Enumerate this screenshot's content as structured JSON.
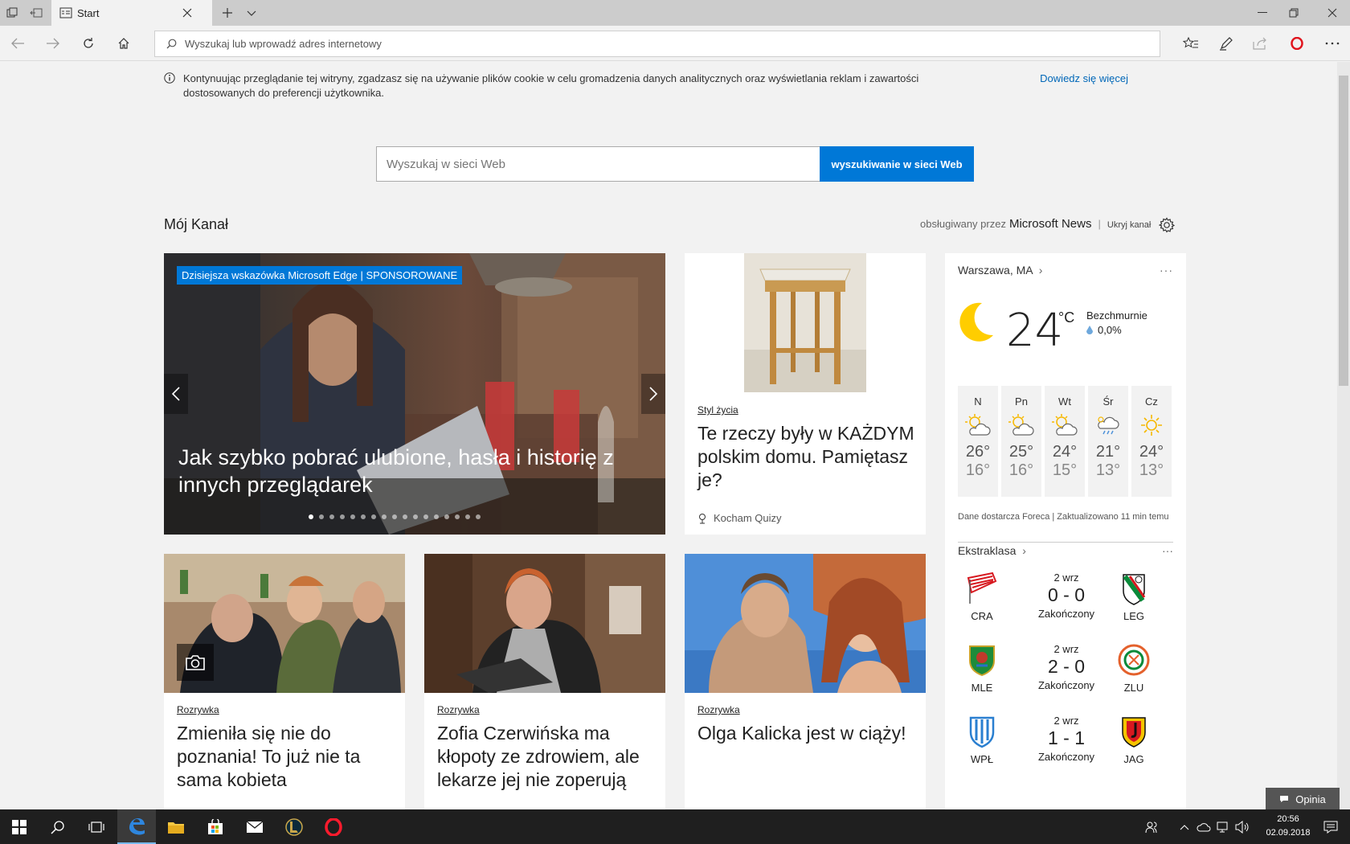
{
  "browser": {
    "tab_title": "Start",
    "address_placeholder": "Wyszukaj lub wprowadź adres internetowy"
  },
  "cookie_notice": {
    "text": "Kontynuując przeglądanie tej witryny, zgadzasz się na używanie plików cookie w celu gromadzenia danych analitycznych oraz wyświetlania reklam i zawartości dostosowanych do preferencji użytkownika.",
    "link": "Dowiedz się więcej"
  },
  "search": {
    "placeholder": "Wyszukaj w sieci Web",
    "button": "wyszukiwanie w sieci Web"
  },
  "feed": {
    "title": "Mój Kanał",
    "powered_by": "obsługiwany przez",
    "provider": "Microsoft News",
    "separator": "|",
    "hide": "Ukryj kanał"
  },
  "hero": {
    "tag": "Dzisiejsza wskazówka Microsoft Edge | SPONSOROWANE",
    "title": "Jak szybko pobrać ulubione, hasła i historię z innych przeglądarek",
    "slide_count": 17,
    "active_slide": 1
  },
  "card_lifestyle": {
    "category": "Styl życia",
    "headline": "Te rzeczy były w KAŻDYM polskim domu. Pamiętasz je?",
    "source": "Kocham Quizy"
  },
  "weather": {
    "location": "Warszawa, MA",
    "more": "···",
    "temp": "24",
    "unit": "°C",
    "condition": "Bezchmurnie",
    "precip": "0,0%",
    "forecast": [
      {
        "day": "N",
        "hi": "26°",
        "lo": "16°",
        "icon": "partly-sunny-icon"
      },
      {
        "day": "Pn",
        "hi": "25°",
        "lo": "16°",
        "icon": "partly-sunny-icon"
      },
      {
        "day": "Wt",
        "hi": "24°",
        "lo": "15°",
        "icon": "partly-sunny-icon"
      },
      {
        "day": "Śr",
        "hi": "21°",
        "lo": "13°",
        "icon": "rain-shower-icon"
      },
      {
        "day": "Cz",
        "hi": "24°",
        "lo": "13°",
        "icon": "sunny-icon"
      }
    ],
    "credit": "Dane dostarcza Foreca | Zaktualizowano 11 min temu"
  },
  "league": {
    "name": "Ekstraklasa",
    "more": "···",
    "matches": [
      {
        "home": "CRA",
        "away": "LEG",
        "date": "2 wrz",
        "score": "0 - 0",
        "status": "Zakończony"
      },
      {
        "home": "MLE",
        "away": "ZLU",
        "date": "2 wrz",
        "score": "2 - 0",
        "status": "Zakończony"
      },
      {
        "home": "WPŁ",
        "away": "JAG",
        "date": "2 wrz",
        "score": "1 - 1",
        "status": "Zakończony"
      }
    ]
  },
  "cards": [
    {
      "category": "Rozrywka",
      "headline": "Zmieniła się nie do poznania! To już nie ta sama kobieta"
    },
    {
      "category": "Rozrywka",
      "headline": "Zofia Czerwińska ma kłopoty ze zdrowiem, ale lekarze jej nie zoperują"
    },
    {
      "category": "Rozrywka",
      "headline": "Olga Kalicka jest w ciąży!"
    }
  ],
  "feedback": {
    "label": "Opinia"
  },
  "taskbar": {
    "time": "20:56",
    "date": "02.09.2018"
  },
  "colors": {
    "accent": "#0078d7",
    "link": "#0067b8"
  }
}
